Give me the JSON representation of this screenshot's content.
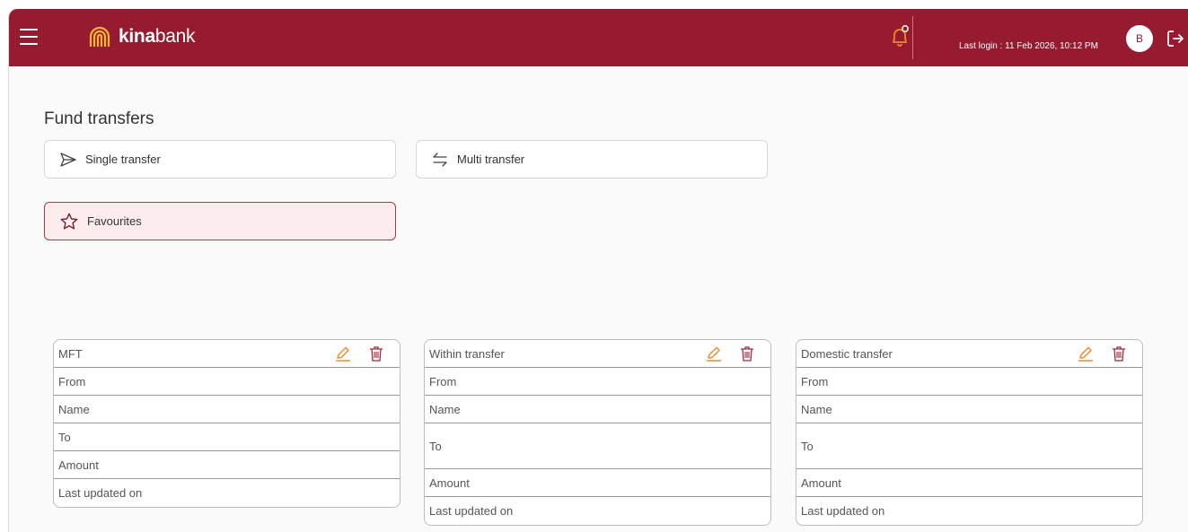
{
  "header": {
    "brand_bold": "kina",
    "brand_light": "bank",
    "last_login": "Last login : 11 Feb 2026, 10:12 PM",
    "avatar_initial": "B"
  },
  "page": {
    "title": "Fund transfers"
  },
  "transfer_options": {
    "single_label": "Single transfer",
    "multi_label": "Multi transfer",
    "favourites_label": "Favourites"
  },
  "favourites": [
    {
      "title": "MFT",
      "fields": [
        "From",
        "Name",
        "To",
        "Amount",
        "Last updated on"
      ]
    },
    {
      "title": "Within transfer",
      "fields": [
        "From",
        "Name",
        "To",
        "Amount",
        "Last updated on"
      ]
    },
    {
      "title": "Domestic transfer",
      "fields": [
        "From",
        "Name",
        "To",
        "Amount",
        "Last updated on"
      ]
    }
  ],
  "colors": {
    "brand": "#961b31",
    "accent_icon": "#f08a24",
    "favourites_bg": "#fdeced"
  }
}
